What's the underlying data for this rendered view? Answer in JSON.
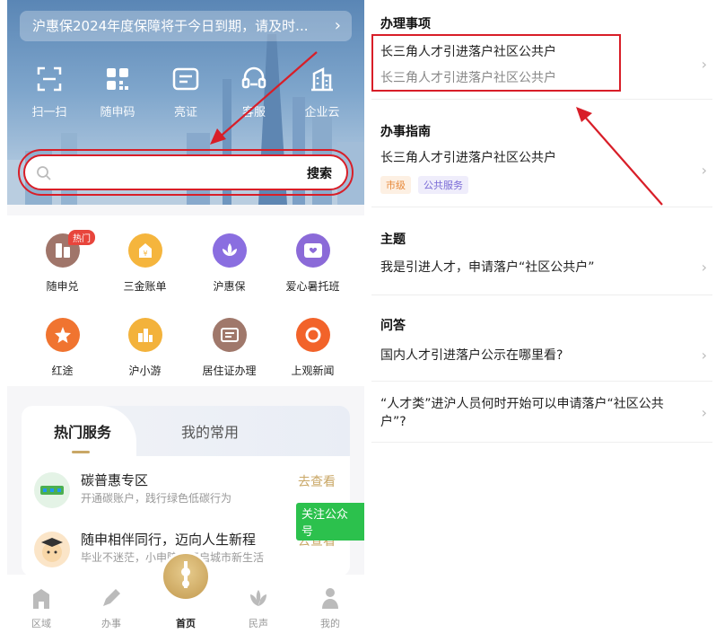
{
  "left": {
    "notice": {
      "text": "沪惠保2024年度保障将于今日到期，请及时...",
      "chevron": "chevron-right-icon"
    },
    "quick_actions": [
      {
        "label": "扫一扫",
        "icon": "scan-icon"
      },
      {
        "label": "随申码",
        "icon": "qr-code-icon"
      },
      {
        "label": "亮证",
        "icon": "id-card-icon"
      },
      {
        "label": "客服",
        "icon": "headset-icon"
      },
      {
        "label": "企业云",
        "icon": "building-icon"
      }
    ],
    "search": {
      "button_label": "搜索",
      "icon": "search-icon"
    },
    "apps": [
      {
        "label": "随申兑",
        "icon": "exchange-icon",
        "color": "#a0756a",
        "badge": "热门"
      },
      {
        "label": "三金账单",
        "icon": "coin-icon",
        "color": "#f5b53d"
      },
      {
        "label": "沪惠保",
        "icon": "lotus-icon",
        "color": "#8a6ee0"
      },
      {
        "label": "爱心暑托班",
        "icon": "heart-card-icon",
        "color": "#8b6ad8"
      },
      {
        "label": "红途",
        "icon": "star-icon",
        "color": "#f07430"
      },
      {
        "label": "沪小游",
        "icon": "city-icon",
        "color": "#f3b23b"
      },
      {
        "label": "居住证办理",
        "icon": "residence-card-icon",
        "color": "#a0786b"
      },
      {
        "label": "上观新闻",
        "icon": "news-ring-icon",
        "color": "#f2632a"
      }
    ],
    "service_card": {
      "tabs": [
        "热门服务",
        "我的常用"
      ],
      "items": [
        {
          "title": "碳普惠专区",
          "subtitle": "开通碳账户，践行绿色低碳行为",
          "action": "去查看"
        },
        {
          "title": "随申相伴同行，迈向人生新程",
          "subtitle": "毕业不迷茫，小申陪你开启城市新生活",
          "action": "去查看"
        }
      ],
      "follow_label": "关注公众号"
    },
    "tabbar": [
      {
        "label": "区域",
        "icon": "district-icon"
      },
      {
        "label": "办事",
        "icon": "pen-icon"
      },
      {
        "label": "首页",
        "icon": "home-tower-icon"
      },
      {
        "label": "民声",
        "icon": "flower-icon"
      },
      {
        "label": "我的",
        "icon": "person-icon"
      }
    ]
  },
  "right": {
    "sections": {
      "handle": {
        "title": "办理事项",
        "item_title": "长三角人才引进落户社区公共户",
        "item_subtitle": "长三角人才引进落户社区公共户"
      },
      "guide": {
        "title": "办事指南",
        "item_title": "长三角人才引进落户社区公共户",
        "tags": [
          "市级",
          "公共服务"
        ]
      },
      "topic": {
        "title": "主题",
        "item_title": "我是引进人才，申请落户“社区公共户”"
      },
      "qa": {
        "title": "问答",
        "items": [
          "国内人才引进落户公示在哪里看?",
          "“人才类”进沪人员何时开始可以申请落户“社区公共户”?"
        ]
      }
    },
    "colors": {
      "highlight": "#d81e28",
      "tag_orange": "#e7893a",
      "tag_purple": "#7a6bd6"
    }
  }
}
